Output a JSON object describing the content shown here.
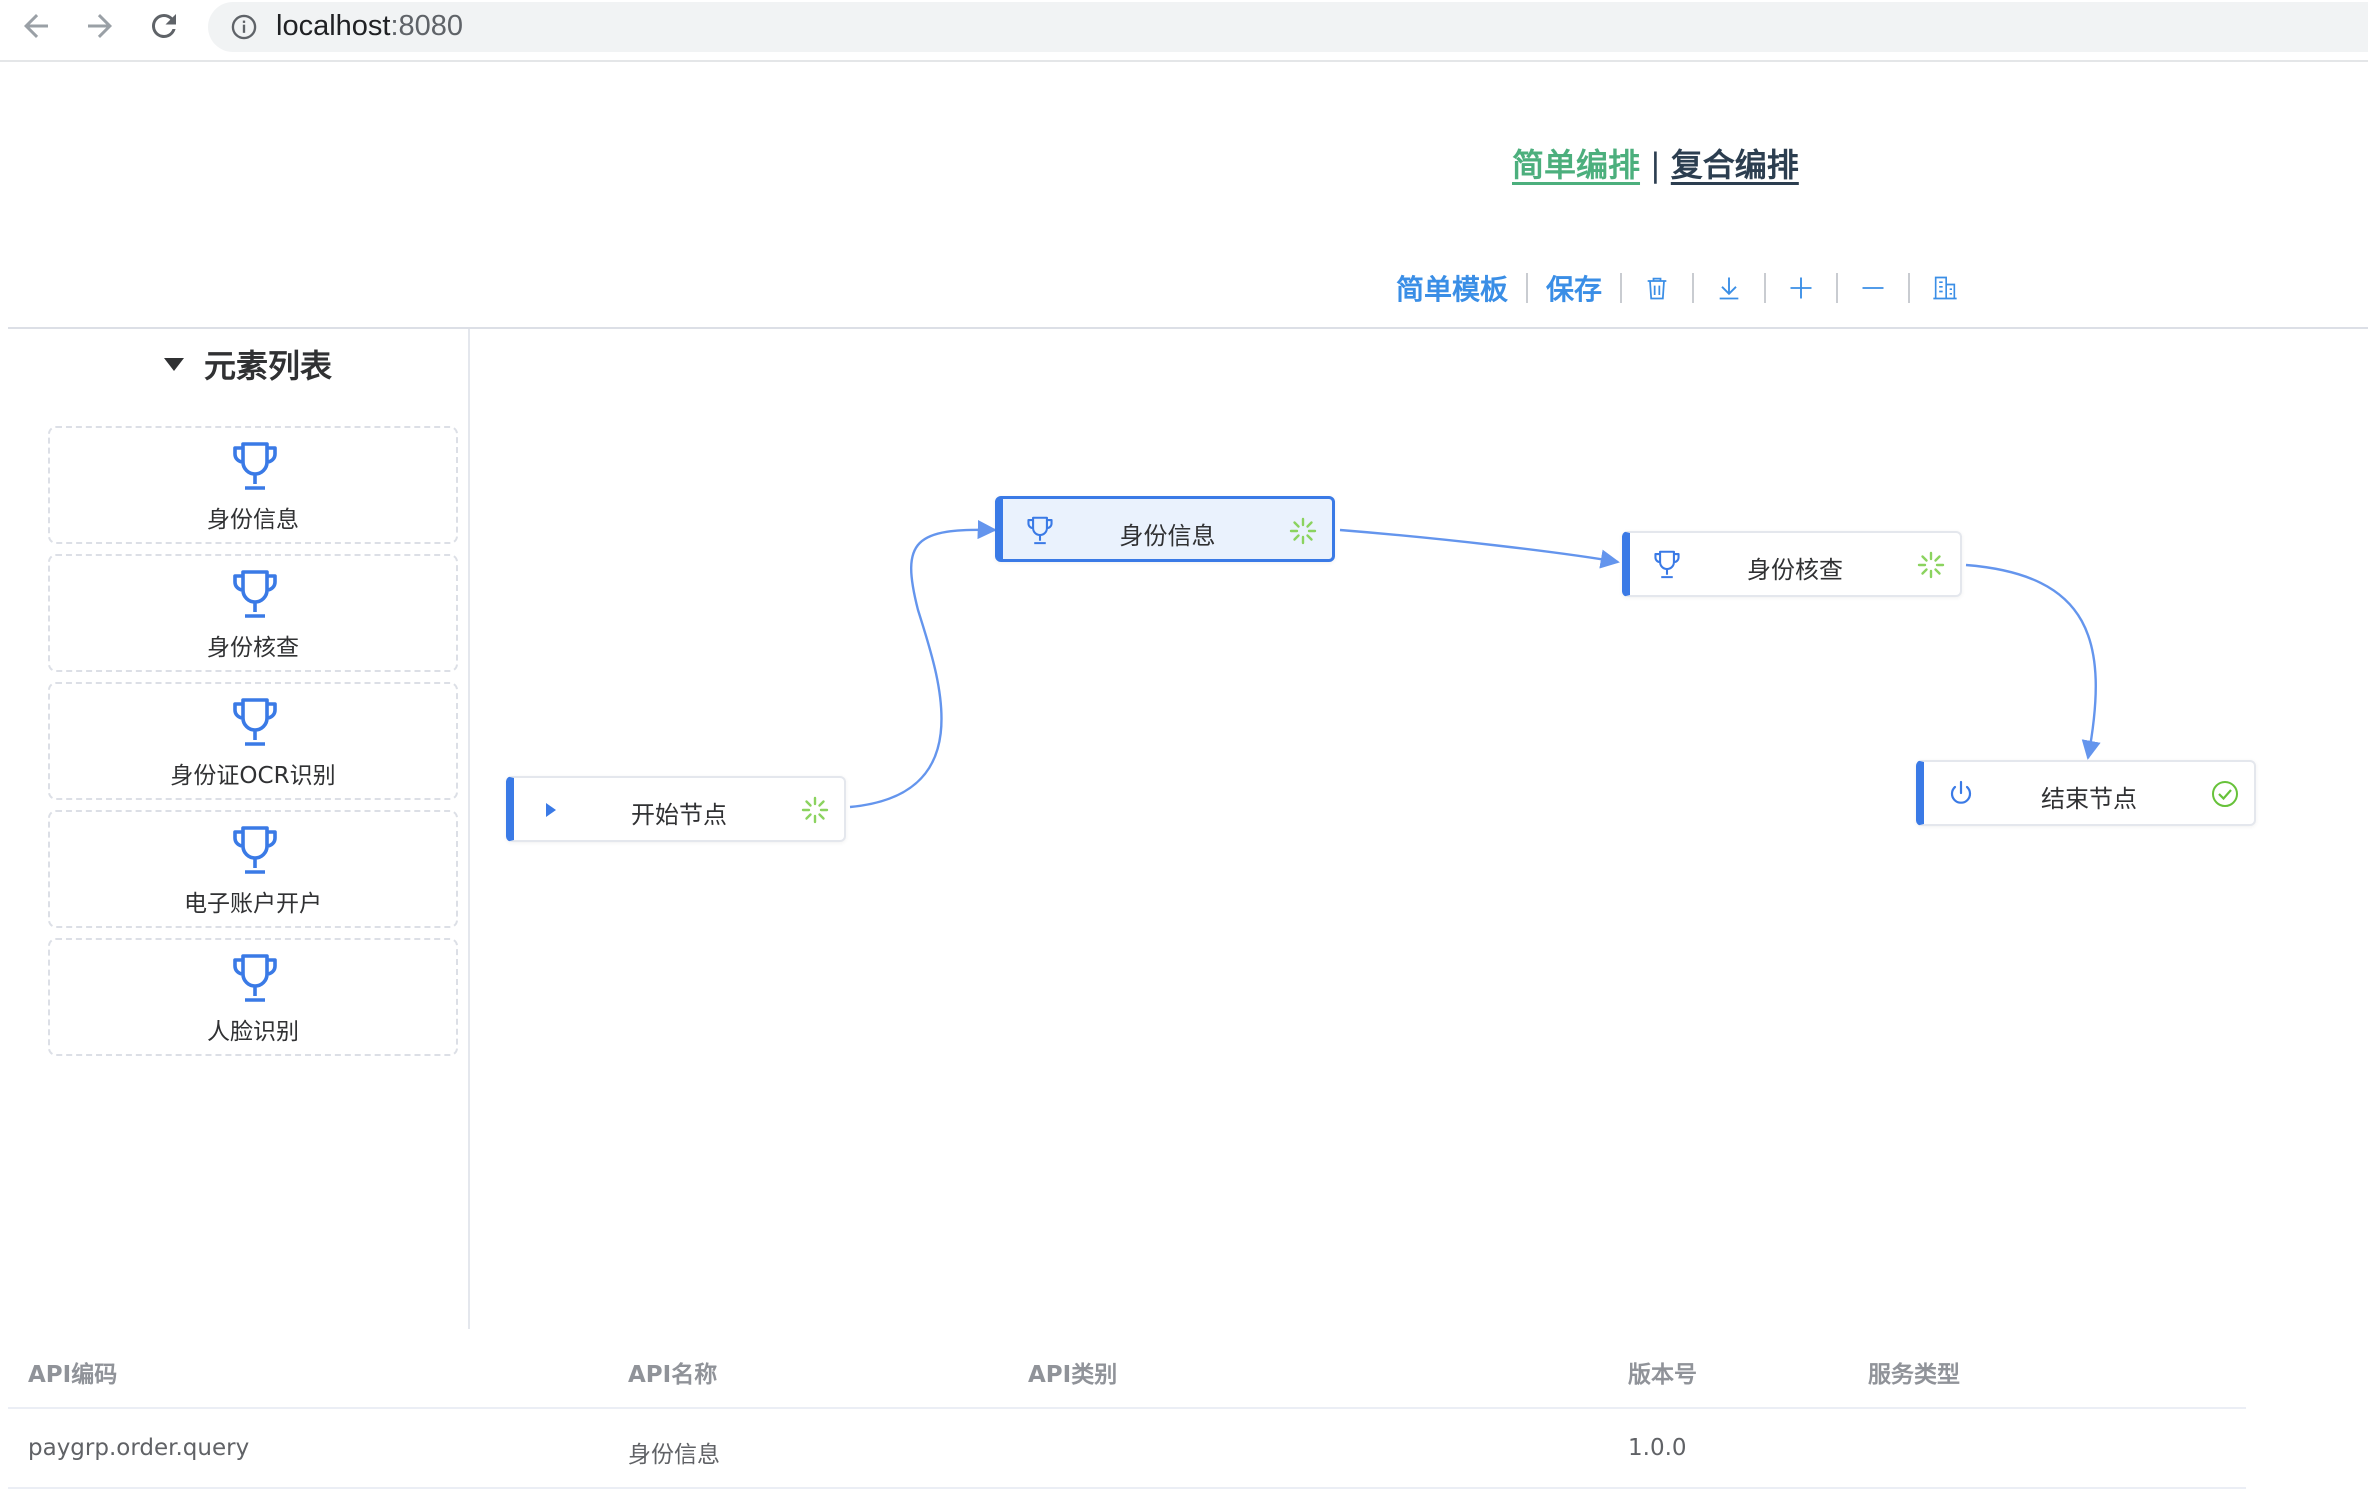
{
  "browser": {
    "url_host": "localhost",
    "url_port": ":8080"
  },
  "mode_switch": {
    "simple_label": "简单编排",
    "separator": "|",
    "complex_label": "复合编排"
  },
  "toolbar": {
    "template_label": "简单模板",
    "save_label": "保存",
    "icons": [
      "delete-icon",
      "download-icon",
      "zoom-in-icon",
      "zoom-out-icon",
      "fit-icon"
    ]
  },
  "sidebar": {
    "title": "元素列表",
    "items": [
      {
        "label": "身份信息",
        "icon": "trophy-icon"
      },
      {
        "label": "身份核查",
        "icon": "trophy-icon"
      },
      {
        "label": "身份证OCR识别",
        "icon": "trophy-icon"
      },
      {
        "label": "电子账户开户",
        "icon": "trophy-icon"
      },
      {
        "label": "人脸识别",
        "icon": "trophy-icon"
      }
    ]
  },
  "flow": {
    "nodes": [
      {
        "id": "start",
        "label": "开始节点",
        "icon": "play-icon",
        "status": "loading"
      },
      {
        "id": "identity-info",
        "label": "身份信息",
        "icon": "trophy-icon",
        "status": "loading",
        "selected": true
      },
      {
        "id": "identity-check",
        "label": "身份核查",
        "icon": "trophy-icon",
        "status": "loading"
      },
      {
        "id": "end",
        "label": "结束节点",
        "icon": "power-icon",
        "status": "success"
      }
    ],
    "edges": [
      {
        "from": "start",
        "to": "identity-info"
      },
      {
        "from": "identity-info",
        "to": "identity-check"
      },
      {
        "from": "identity-check",
        "to": "end"
      }
    ]
  },
  "table": {
    "headers": [
      "API编码",
      "API名称",
      "API类别",
      "版本号",
      "服务类型"
    ],
    "rows": [
      [
        "paygrp.order.query",
        "身份信息",
        "",
        "1.0.0",
        ""
      ]
    ]
  },
  "colors": {
    "accent": "#3a7ae6",
    "link": "#3a8ee6",
    "success": "#67c23a",
    "simple_mode": "#4caf7d"
  }
}
